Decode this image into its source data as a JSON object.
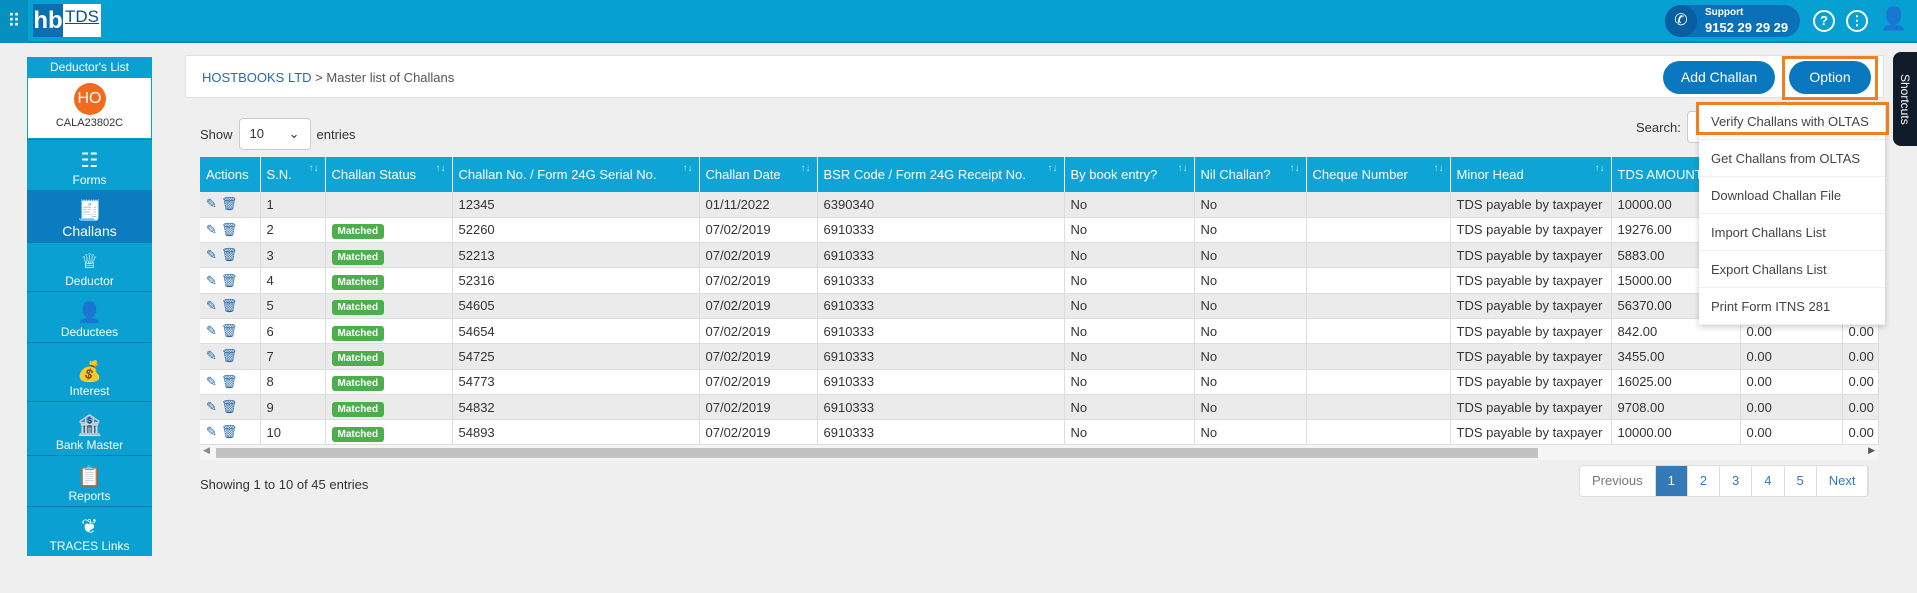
{
  "header": {
    "logo_hb": "hb",
    "logo_tds": "TDS",
    "support_label": "Support",
    "support_phone": "9152 29 29 29"
  },
  "sidebar": {
    "title": "Deductor's List",
    "avatar_initials": "HO",
    "deductor_id": "CALA23802C",
    "items": [
      {
        "label": "Forms",
        "icon": "forms-icon"
      },
      {
        "label": "Challans",
        "icon": "challan-icon",
        "active": true
      },
      {
        "label": "Deductor",
        "icon": "crown-icon"
      },
      {
        "label": "Deductees",
        "icon": "person-icon"
      },
      {
        "label": "Interest",
        "icon": "money-bag-icon"
      },
      {
        "label": "Bank Master",
        "icon": "bank-icon"
      },
      {
        "label": "Reports",
        "icon": "report-icon"
      },
      {
        "label": "TRACES Links",
        "icon": "traces-icon"
      }
    ]
  },
  "breadcrumb": {
    "company": "HOSTBOOKS LTD",
    "sep": " > ",
    "page": "Master list of Challans"
  },
  "buttons": {
    "add": "Add Challan",
    "option": "Option"
  },
  "options_menu": [
    "Verify Challans with OLTAS",
    "Get Challans from OLTAS",
    "Download Challan File",
    "Import Challans List",
    "Export Challans List",
    "Print Form ITNS 281"
  ],
  "length": {
    "show": "Show",
    "value": "10",
    "entries": "entries"
  },
  "search_label": "Search:",
  "table": {
    "columns": [
      "Actions",
      "S.N.",
      "Challan Status",
      "Challan No. / Form 24G Serial No.",
      "Challan Date",
      "BSR Code / Form 24G Receipt No.",
      "By book entry?",
      "Nil Challan?",
      "Cheque Number",
      "Minor Head",
      "TDS AMOUNT",
      "",
      ""
    ],
    "rows": [
      [
        "1",
        "",
        "12345",
        "01/11/2022",
        "6390340",
        "No",
        "No",
        "",
        "TDS payable by taxpayer",
        "10000.00",
        "0.00",
        "0.00"
      ],
      [
        "2",
        "Matched",
        "52260",
        "07/02/2019",
        "6910333",
        "No",
        "No",
        "",
        "TDS payable by taxpayer",
        "19276.00",
        "0.00",
        "0.00"
      ],
      [
        "3",
        "Matched",
        "52213",
        "07/02/2019",
        "6910333",
        "No",
        "No",
        "",
        "TDS payable by taxpayer",
        "5883.00",
        "0.00",
        "0.00"
      ],
      [
        "4",
        "Matched",
        "52316",
        "07/02/2019",
        "6910333",
        "No",
        "No",
        "",
        "TDS payable by taxpayer",
        "15000.00",
        "0.00",
        "0.00"
      ],
      [
        "5",
        "Matched",
        "54605",
        "07/02/2019",
        "6910333",
        "No",
        "No",
        "",
        "TDS payable by taxpayer",
        "56370.00",
        "0.00",
        "0.00"
      ],
      [
        "6",
        "Matched",
        "54654",
        "07/02/2019",
        "6910333",
        "No",
        "No",
        "",
        "TDS payable by taxpayer",
        "842.00",
        "0.00",
        "0.00"
      ],
      [
        "7",
        "Matched",
        "54725",
        "07/02/2019",
        "6910333",
        "No",
        "No",
        "",
        "TDS payable by taxpayer",
        "3455.00",
        "0.00",
        "0.00"
      ],
      [
        "8",
        "Matched",
        "54773",
        "07/02/2019",
        "6910333",
        "No",
        "No",
        "",
        "TDS payable by taxpayer",
        "16025.00",
        "0.00",
        "0.00"
      ],
      [
        "9",
        "Matched",
        "54832",
        "07/02/2019",
        "6910333",
        "No",
        "No",
        "",
        "TDS payable by taxpayer",
        "9708.00",
        "0.00",
        "0.00"
      ],
      [
        "10",
        "Matched",
        "54893",
        "07/02/2019",
        "6910333",
        "No",
        "No",
        "",
        "TDS payable by taxpayer",
        "10000.00",
        "0.00",
        "0.00"
      ]
    ]
  },
  "info": "Showing 1 to 10 of 45 entries",
  "pagination": [
    "Previous",
    "1",
    "2",
    "3",
    "4",
    "5",
    "Next"
  ],
  "shortcuts": "Shortcuts",
  "colors": {
    "topbar": "#06a0d2",
    "button": "#0a78c0",
    "matched": "#4cae4c",
    "highlight": "#f07f22"
  }
}
